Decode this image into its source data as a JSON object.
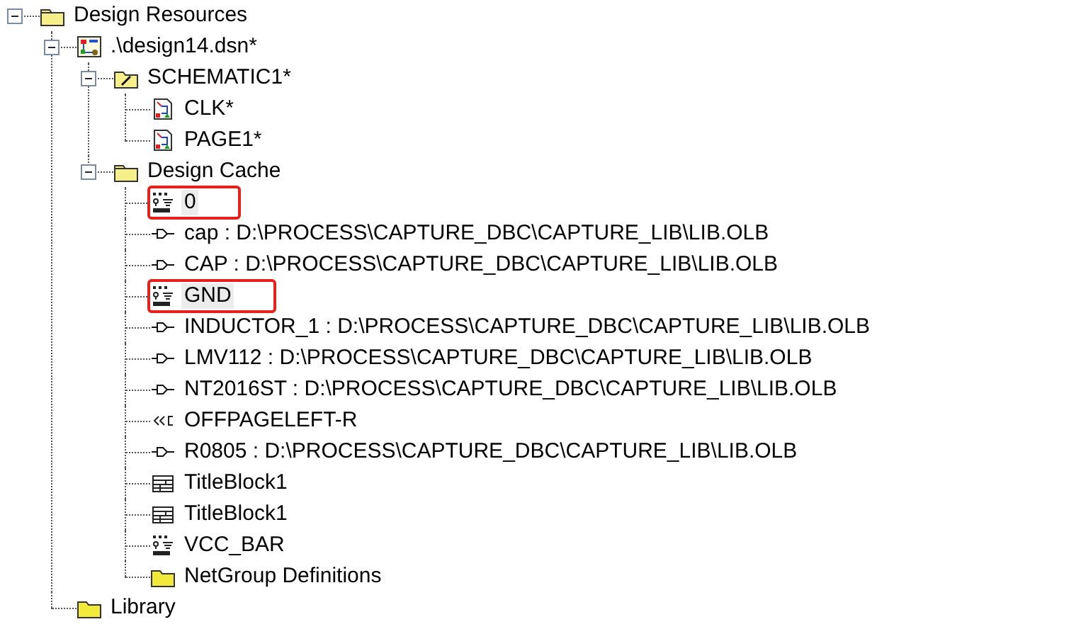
{
  "tree": [
    {
      "label": "Design Resources",
      "kind": "folder-open",
      "expanded": true,
      "children": [
        {
          "label": ".\\design14.dsn*",
          "kind": "design",
          "expanded": true,
          "children": [
            {
              "label": "SCHEMATIC1*",
              "kind": "schematic",
              "expanded": true,
              "children": [
                {
                  "label": "CLK*",
                  "kind": "page"
                },
                {
                  "label": "PAGE1*",
                  "kind": "page"
                }
              ]
            },
            {
              "label": "Design Cache",
              "kind": "folder-open",
              "expanded": true,
              "children": [
                {
                  "label": "0",
                  "kind": "power",
                  "highlighted": true
                },
                {
                  "label": "cap : D:\\PROCESS\\CAPTURE_DBC\\CAPTURE_LIB\\LIB.OLB",
                  "kind": "part"
                },
                {
                  "label": "CAP : D:\\PROCESS\\CAPTURE_DBC\\CAPTURE_LIB\\LIB.OLB",
                  "kind": "part"
                },
                {
                  "label": "GND",
                  "kind": "power",
                  "highlighted": true
                },
                {
                  "label": "INDUCTOR_1 : D:\\PROCESS\\CAPTURE_DBC\\CAPTURE_LIB\\LIB.OLB",
                  "kind": "part"
                },
                {
                  "label": "LMV112 : D:\\PROCESS\\CAPTURE_DBC\\CAPTURE_LIB\\LIB.OLB",
                  "kind": "part"
                },
                {
                  "label": "NT2016ST : D:\\PROCESS\\CAPTURE_DBC\\CAPTURE_LIB\\LIB.OLB",
                  "kind": "part"
                },
                {
                  "label": "OFFPAGELEFT-R",
                  "kind": "offpage"
                },
                {
                  "label": "R0805 : D:\\PROCESS\\CAPTURE_DBC\\CAPTURE_LIB\\LIB.OLB",
                  "kind": "part"
                },
                {
                  "label": "TitleBlock1",
                  "kind": "titleblock"
                },
                {
                  "label": "TitleBlock1",
                  "kind": "titleblock"
                },
                {
                  "label": "VCC_BAR",
                  "kind": "power"
                },
                {
                  "label": "NetGroup Definitions",
                  "kind": "folder"
                }
              ]
            }
          ]
        },
        {
          "label": "Library",
          "kind": "folder"
        }
      ]
    }
  ]
}
